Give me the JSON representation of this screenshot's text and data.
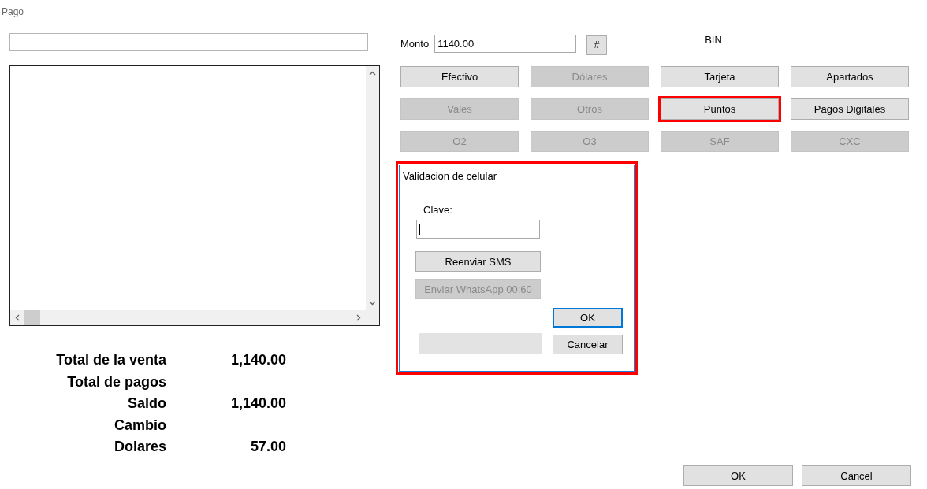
{
  "window": {
    "title": "Pago"
  },
  "monto": {
    "label": "Monto",
    "value": "1140.00"
  },
  "hash_button": "#",
  "bin_label": "BIN",
  "payment_buttons": [
    {
      "label": "Efectivo",
      "disabled": false,
      "highlighted": false
    },
    {
      "label": "Dólares",
      "disabled": true,
      "highlighted": false
    },
    {
      "label": "Tarjeta",
      "disabled": false,
      "highlighted": false
    },
    {
      "label": "Apartados",
      "disabled": false,
      "highlighted": false
    },
    {
      "label": "Vales",
      "disabled": true,
      "highlighted": false
    },
    {
      "label": "Otros",
      "disabled": true,
      "highlighted": false
    },
    {
      "label": "Puntos",
      "disabled": false,
      "highlighted": true
    },
    {
      "label": "Pagos Digitales",
      "disabled": false,
      "highlighted": false
    },
    {
      "label": "O2",
      "disabled": true,
      "highlighted": false
    },
    {
      "label": "O3",
      "disabled": true,
      "highlighted": false
    },
    {
      "label": "SAF",
      "disabled": true,
      "highlighted": false
    },
    {
      "label": "CXC",
      "disabled": true,
      "highlighted": false
    }
  ],
  "validation_panel": {
    "title": "Validacion de celular",
    "highlighted": true,
    "clave_label": "Clave:",
    "resend_button": "Reenviar SMS",
    "whatsapp_button": {
      "label": "Enviar WhatsApp 00:60",
      "disabled": true
    },
    "ok_button": {
      "label": "OK",
      "focused": true
    },
    "cancel_button": "Cancelar"
  },
  "totals": [
    {
      "label": "Total de la venta",
      "value": "1,140.00"
    },
    {
      "label": "Total de pagos"
    },
    {
      "label": "Saldo",
      "value": "1,140.00"
    },
    {
      "label": "Cambio"
    },
    {
      "label": "Dolares",
      "value": "57.00"
    }
  ],
  "footer_buttons": [
    "OK",
    "Cancel"
  ]
}
